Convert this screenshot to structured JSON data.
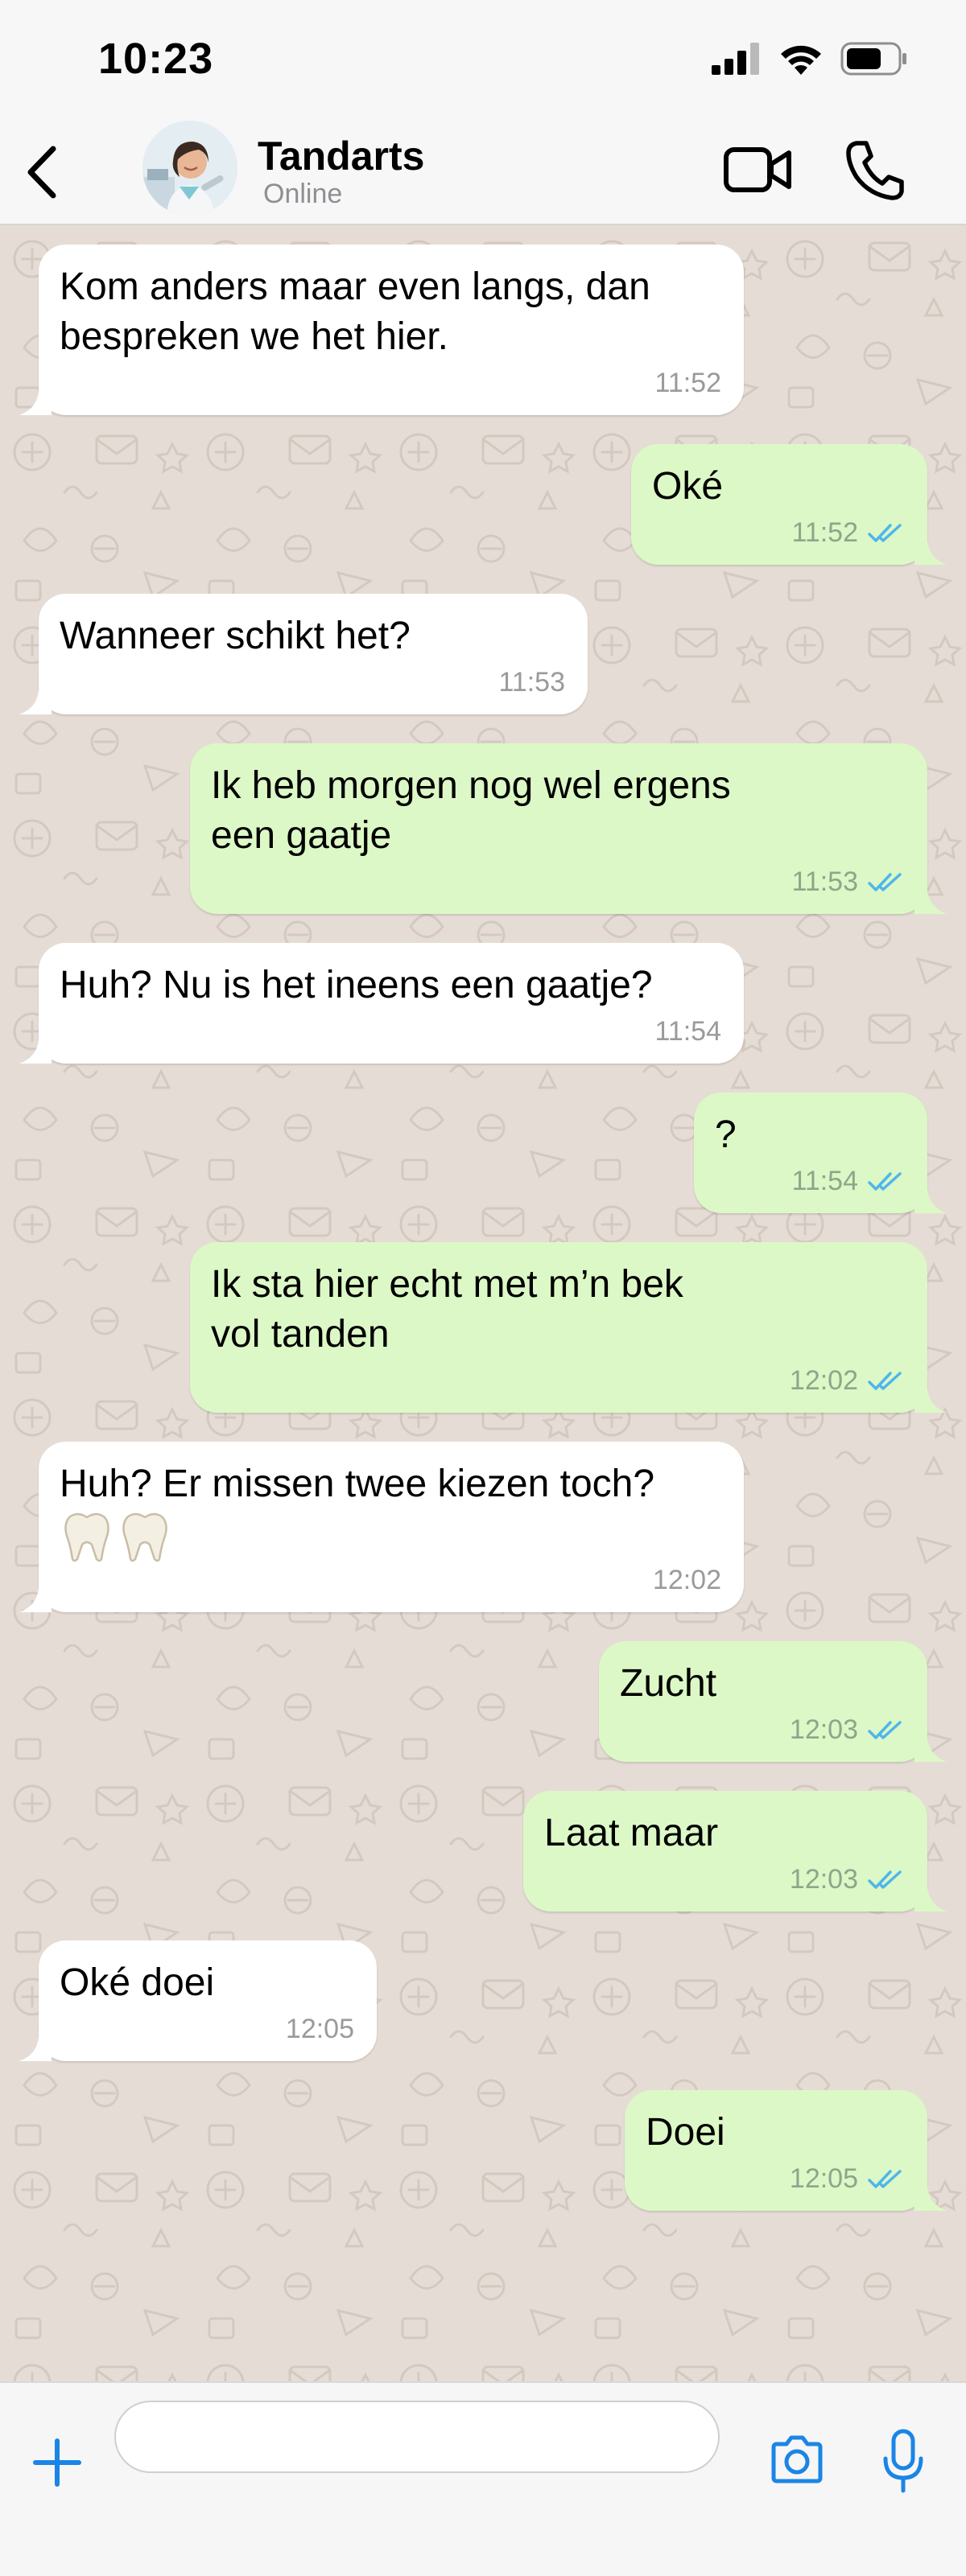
{
  "status_bar": {
    "time": "10:23"
  },
  "header": {
    "contact_name": "Tandarts",
    "contact_status": "Online",
    "icons": [
      "chevron-left-icon",
      "video-call-icon",
      "phone-icon"
    ]
  },
  "messages": [
    {
      "direction": "incoming",
      "lines": [
        "Kom anders maar even langs, dan",
        "bespreken we het hier."
      ],
      "time": "11:52"
    },
    {
      "direction": "outgoing",
      "lines": [
        "Oké"
      ],
      "time": "11:52",
      "read": true
    },
    {
      "direction": "incoming",
      "lines": [
        "Wanneer schikt het?"
      ],
      "time": "11:53"
    },
    {
      "direction": "outgoing",
      "lines": [
        "Ik heb morgen nog wel ergens",
        "een gaatje"
      ],
      "time": "11:53",
      "read": true
    },
    {
      "direction": "incoming",
      "lines": [
        "Huh? Nu is het ineens een gaatje?"
      ],
      "time": "11:54"
    },
    {
      "direction": "outgoing",
      "lines": [
        "?"
      ],
      "time": "11:54",
      "read": true
    },
    {
      "direction": "outgoing",
      "lines": [
        "Ik sta hier echt met m’n bek",
        "vol tanden"
      ],
      "time": "12:02",
      "read": true
    },
    {
      "direction": "incoming",
      "lines": [
        "Huh? Er missen twee kiezen toch?"
      ],
      "emoji": "tooth,tooth",
      "time": "12:02"
    },
    {
      "direction": "outgoing",
      "lines": [
        "Zucht"
      ],
      "time": "12:03",
      "read": true
    },
    {
      "direction": "outgoing",
      "lines": [
        "Laat maar"
      ],
      "time": "12:03",
      "read": true
    },
    {
      "direction": "incoming",
      "lines": [
        "Oké doei"
      ],
      "time": "12:05"
    },
    {
      "direction": "outgoing",
      "lines": [
        "Doei"
      ],
      "time": "12:05",
      "read": true
    }
  ],
  "input_bar": {
    "placeholder": "",
    "icons": [
      "plus-icon",
      "camera-icon",
      "microphone-icon"
    ]
  },
  "colors": {
    "accent": "#1a85e6",
    "outgoing_bubble": "#dcf8c6",
    "incoming_bubble": "#ffffff",
    "chat_background": "#e5ddd5",
    "read_ticks": "#4fb6ec"
  }
}
